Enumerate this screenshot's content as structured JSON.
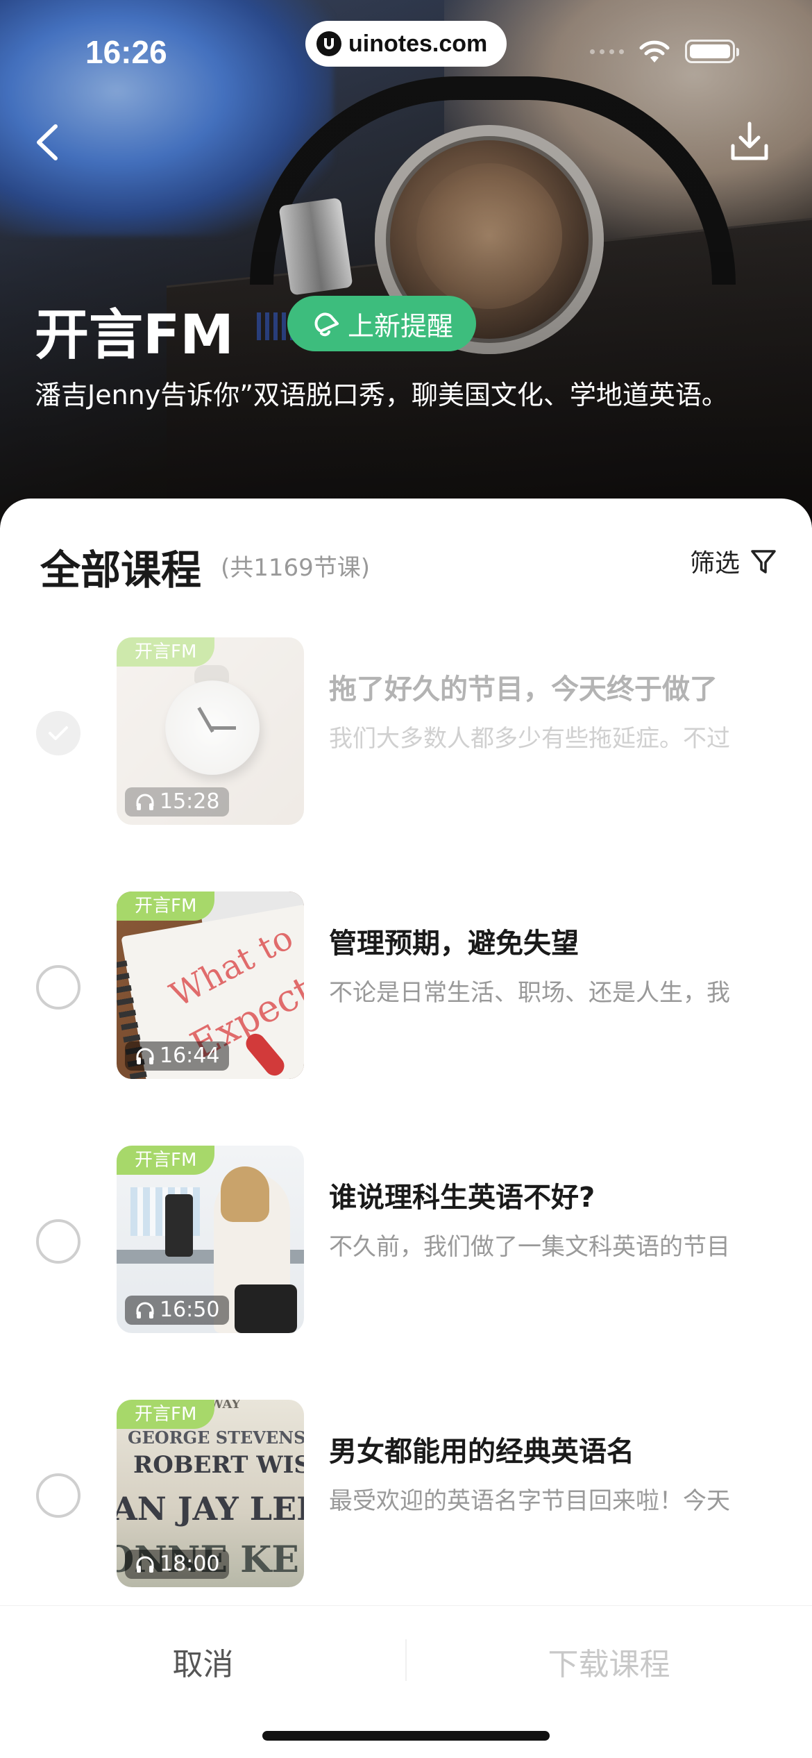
{
  "status_bar": {
    "time": "16:26",
    "site": "uinotes.com"
  },
  "hero": {
    "title": "开言FM",
    "remind_label": "上新提醒",
    "description": "潘吉Jenny告诉你”双语脱口秀，聊美国文化、学地道英语。",
    "accent_color": "#3dbd7d"
  },
  "sheet": {
    "title": "全部课程",
    "count": "(共1169节课)",
    "filter_label": "筛选"
  },
  "lessons": [
    {
      "tag": "开言FM",
      "duration": "15:28",
      "title": "拖了好久的节目，今天终于做了",
      "desc": "我们大多数人都多少有些拖延症。不过",
      "state": "downloaded"
    },
    {
      "tag": "开言FM",
      "duration": "16:44",
      "title": "管理预期，避免失望",
      "desc": "不论是日常生活、职场、还是人生，我",
      "state": "unchecked",
      "thumb_text_1": "What to",
      "thumb_text_2": "Expect"
    },
    {
      "tag": "开言FM",
      "duration": "16:50",
      "title": "谁说理科生英语不好?",
      "desc": "不久前，我们做了一集文科英语的节目",
      "state": "unchecked"
    },
    {
      "tag": "开言FM",
      "duration": "18:00",
      "title": "男女都能用的经典英语名",
      "desc": "最受欢迎的英语名字节目回来啦！今天",
      "state": "unchecked",
      "thumb_lines": [
        "HATHAWAY",
        "GEORGE STEVENS",
        "ROBERT WISE",
        "AN JAY LERN",
        "ONNE KE"
      ]
    }
  ],
  "bottom_bar": {
    "cancel_label": "取消",
    "download_label": "下载课程"
  }
}
